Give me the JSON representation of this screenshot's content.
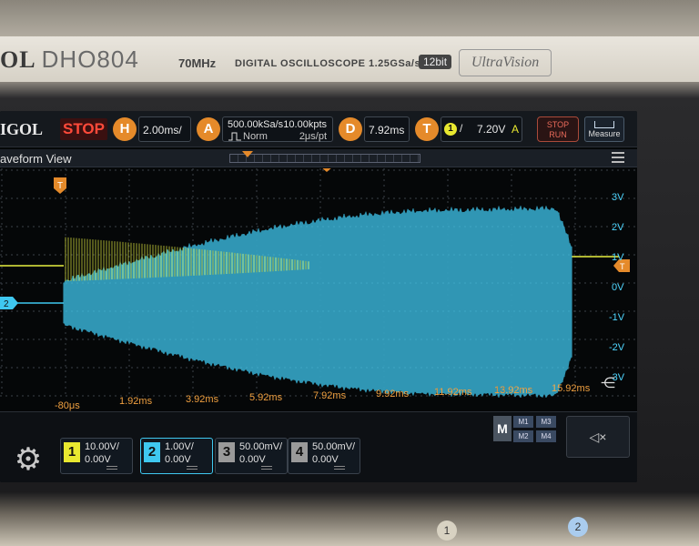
{
  "bezel": {
    "brand": "OL",
    "model": "DHO804",
    "bandwidth": "70MHz",
    "kind": "DIGITAL OSCILLOSCOPE 1.25GSa/s",
    "bits": "12bit",
    "series": "UltraVision"
  },
  "topbar": {
    "logo": "IGOL",
    "run_state": "STOP",
    "horizontal": {
      "badge": "H",
      "value": "2.00ms/"
    },
    "acquire": {
      "badge": "A",
      "rate": "500.00kSa/s",
      "mode": "Norm",
      "points": "10.00kpts",
      "per_point": "2μs/pt"
    },
    "delay": {
      "badge": "D",
      "value": "7.92ms"
    },
    "trigger": {
      "badge": "T",
      "source": "1",
      "edge": "/",
      "level": "7.20V",
      "coupling": "A"
    },
    "stoprun_label": "STOP RUN",
    "measure_label": "Measure"
  },
  "waveform_view": {
    "title": "aveform View",
    "trigger_marker": "T",
    "ch2_marker": "2",
    "ch1_marker": "T"
  },
  "plot": {
    "volt_labels": [
      "3V",
      "2V",
      "1V",
      "0V",
      "-1V",
      "-2V",
      "-3V"
    ],
    "time_labels": [
      "-80μs",
      "1.92ms",
      "3.92ms",
      "5.92ms",
      "7.92ms",
      "9.92ms",
      "11.92ms",
      "13.92ms",
      "15.92ms"
    ],
    "colors": {
      "ch1": "#e8f040",
      "ch2": "#3fc8f0",
      "grid": "#3a4048",
      "trigger": "#e58a2a"
    }
  },
  "channels": [
    {
      "num": "1",
      "scale": "10.00V/",
      "offset": "0.00V",
      "color": "#e8e830"
    },
    {
      "num": "2",
      "scale": "1.00V/",
      "offset": "0.00V",
      "color": "#3fc8f0"
    },
    {
      "num": "3",
      "scale": "50.00mV/",
      "offset": "0.00V",
      "color": "#9a9a9a"
    },
    {
      "num": "4",
      "scale": "50.00mV/",
      "offset": "0.00V",
      "color": "#9a9a9a"
    }
  ],
  "math": {
    "badge": "M",
    "cells": [
      "M1",
      "M3",
      "M2",
      "M4"
    ]
  },
  "icons": {
    "settings": "gear-icon",
    "speaker": "speaker-mute-icon",
    "zoom": "zoom-icon"
  },
  "knobs": [
    "1",
    "2"
  ]
}
